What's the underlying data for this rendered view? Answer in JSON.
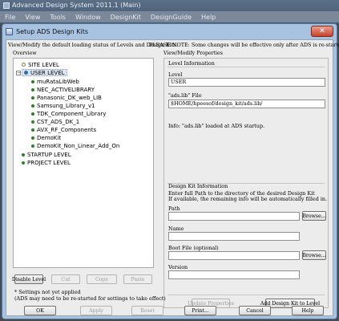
{
  "background_app": {
    "title": "Advanced Design System 2011.1 (Main)",
    "menu": [
      "File",
      "View",
      "Tools",
      "Window",
      "DesignKit",
      "DesignGuide",
      "Help"
    ]
  },
  "dialog": {
    "title": "Setup ADS Design Kits",
    "close_label": "✕",
    "description": "View/Modify the default loading status of Levels and Design Kits.",
    "note": "PLEASE NOTE: Some changes will be effective only after ADS is re-started."
  },
  "overview": {
    "label": "Overview",
    "items": [
      {
        "label": "SITE LEVEL"
      },
      {
        "label": "USER LEVEL"
      },
      {
        "label": "muRataLibWeb"
      },
      {
        "label": "NEC_ACTIVELIBRARY"
      },
      {
        "label": "Panasonic_DK_web_LIB"
      },
      {
        "label": "Samsung_Library_v1"
      },
      {
        "label": "TDK_Component_Library"
      },
      {
        "label": "CST_ADS_DK_1"
      },
      {
        "label": "AVX_RF_Components"
      },
      {
        "label": "DemoKit"
      },
      {
        "label": "DemoKit_Non_Linear_Add_On"
      },
      {
        "label": "STARTUP LEVEL"
      },
      {
        "label": "PROJECT LEVEL"
      }
    ],
    "buttons": {
      "disable": "Disable Level",
      "cut": "Cut",
      "copy": "Copy",
      "paste": "Paste"
    },
    "footnote_1": "* Settings not yet applied",
    "footnote_2": "(ADS may need to be re-started for settings to take effect)"
  },
  "properties": {
    "label": "View/Modify Properties",
    "level_info_label": "Level Information",
    "level_label": "Level",
    "level_value": "USER",
    "ads_lib_label": "\"ads.lib\" File",
    "ads_lib_value": "$HOME/hpeesof/design_kit/ads.lib/",
    "info_text": "Info: \"ads.lib\" loaded at ADS startup.",
    "design_kit_label": "Design Kit Information",
    "design_kit_hint_1": "Enter full Path to the directory of the desired Design Kit",
    "design_kit_hint_2": "If available, the remaining info will be automatically filled in.",
    "path_label": "Path",
    "path_value": "",
    "browse_label": "Browse...",
    "name_label": "Name",
    "name_value": "",
    "boot_label": "Boot File (optional)",
    "boot_value": "",
    "version_label": "Version",
    "version_value": "",
    "update_button": "Update Properties",
    "add_button": "Add Design Kit to Level"
  },
  "footer": {
    "ok": "OK",
    "apply": "Apply",
    "reset": "Reset",
    "print": "Print...",
    "cancel": "Cancel",
    "help": "Help"
  }
}
